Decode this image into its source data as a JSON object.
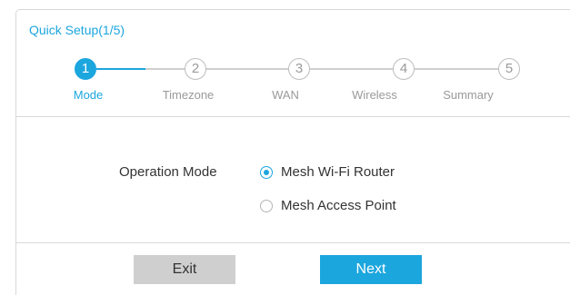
{
  "header": {
    "title": "Quick Setup(1/5)"
  },
  "stepper": {
    "steps": [
      {
        "number": "1",
        "label": "Mode",
        "active": true
      },
      {
        "number": "2",
        "label": "Timezone",
        "active": false
      },
      {
        "number": "3",
        "label": "WAN",
        "active": false
      },
      {
        "number": "4",
        "label": "Wireless",
        "active": false
      },
      {
        "number": "5",
        "label": "Summary",
        "active": false
      }
    ]
  },
  "form": {
    "field_label": "Operation Mode",
    "options": [
      {
        "label": "Mesh Wi-Fi Router",
        "checked": true
      },
      {
        "label": "Mesh Access Point",
        "checked": false
      }
    ]
  },
  "buttons": {
    "exit_label": "Exit",
    "next_label": "Next"
  },
  "colors": {
    "accent": "#1ca6de",
    "inactive": "#9a9a9a",
    "exit_button": "#cfcfcf"
  }
}
